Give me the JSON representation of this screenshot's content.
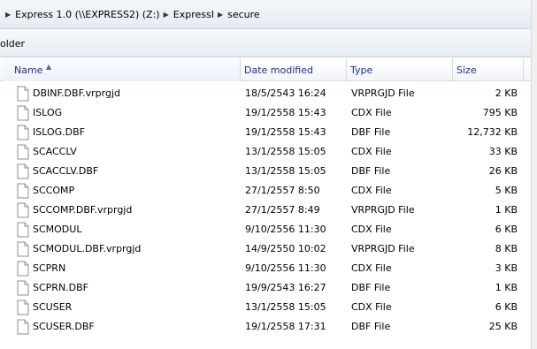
{
  "address": {
    "crumbs": [
      "Express 1.0 (\\\\EXPRESS2) (Z:)",
      "ExpressI",
      "secure"
    ]
  },
  "toolbar": {
    "new_folder_label": "older"
  },
  "columns": {
    "name": "Name",
    "date": "Date modified",
    "type": "Type",
    "size": "Size"
  },
  "files": [
    {
      "name": "DBINF.DBF.vrprgjd",
      "date": "18/5/2543 16:24",
      "type": "VRPRGJD File",
      "size": "2 KB"
    },
    {
      "name": "ISLOG",
      "date": "19/1/2558 15:43",
      "type": "CDX File",
      "size": "795 KB"
    },
    {
      "name": "ISLOG.DBF",
      "date": "19/1/2558 15:43",
      "type": "DBF File",
      "size": "12,732 KB"
    },
    {
      "name": "SCACCLV",
      "date": "13/1/2558 15:05",
      "type": "CDX File",
      "size": "33 KB"
    },
    {
      "name": "SCACCLV.DBF",
      "date": "13/1/2558 15:05",
      "type": "DBF File",
      "size": "26 KB"
    },
    {
      "name": "SCCOMP",
      "date": "27/1/2557 8:50",
      "type": "CDX File",
      "size": "5 KB"
    },
    {
      "name": "SCCOMP.DBF.vrprgjd",
      "date": "27/1/2557 8:49",
      "type": "VRPRGJD File",
      "size": "1 KB"
    },
    {
      "name": "SCMODUL",
      "date": "9/10/2556 11:30",
      "type": "CDX File",
      "size": "6 KB"
    },
    {
      "name": "SCMODUL.DBF.vrprgjd",
      "date": "14/9/2550 10:02",
      "type": "VRPRGJD File",
      "size": "8 KB"
    },
    {
      "name": "SCPRN",
      "date": "9/10/2556 11:30",
      "type": "CDX File",
      "size": "3 KB"
    },
    {
      "name": "SCPRN.DBF",
      "date": "19/9/2543 16:27",
      "type": "DBF File",
      "size": "1 KB"
    },
    {
      "name": "SCUSER",
      "date": "13/1/2558 15:05",
      "type": "CDX File",
      "size": "6 KB"
    },
    {
      "name": "SCUSER.DBF",
      "date": "19/1/2558 17:31",
      "type": "DBF File",
      "size": "25 KB"
    }
  ],
  "icons": {
    "file": "file-icon",
    "breadcrumb_separator": "chevron-right-icon",
    "sort": "sort-ascending-icon"
  },
  "colors": {
    "header_text": "#1e3287",
    "border": "#d5dde7"
  }
}
